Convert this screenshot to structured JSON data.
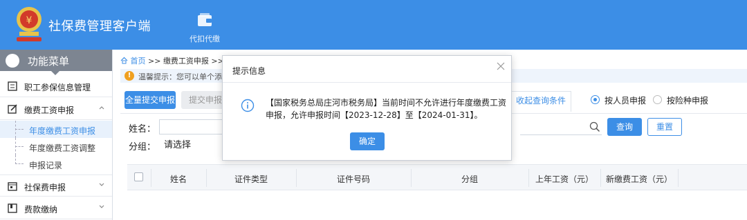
{
  "app": {
    "title": "社保费管理客户端",
    "tool_label": "代扣代缴"
  },
  "sidebar": {
    "header": "功能菜单",
    "items": [
      {
        "label": "职工参保信息管理"
      },
      {
        "label": "缴费工资申报"
      },
      {
        "label": "社保费申报"
      },
      {
        "label": "费款缴纳"
      }
    ],
    "subitems": [
      {
        "label": "年度缴费工资申报"
      },
      {
        "label": "年度缴费工资调整"
      },
      {
        "label": "申报记录"
      }
    ]
  },
  "breadcrumb": {
    "home": "首页",
    "sep": " >> ",
    "level1": "缴费工资申报",
    "tail": " >> 年"
  },
  "notice": "温馨提示：您可以单个添加",
  "toolbar": {
    "submit_all": "全量提交申报",
    "submit": "提交申报",
    "collapse": "收起查询条件",
    "radio_person": "按人员申报",
    "radio_type": "按险种申报",
    "query": "查询",
    "reset": "重置"
  },
  "filters": {
    "name_label": "姓名：",
    "group_label": "分组：",
    "group_value": "请选择"
  },
  "table": {
    "headers": [
      "姓名",
      "证件类型",
      "证件号码",
      "分组",
      "上年工资（元）",
      "新缴费工资（元）"
    ]
  },
  "modal": {
    "title": "提示信息",
    "message": "【国家税务总局庄河市税务局】当前时间不允许进行年度缴费工资申报，允许申报时间【2023-12-28】至【2024-01-31】。",
    "ok": "确定"
  }
}
